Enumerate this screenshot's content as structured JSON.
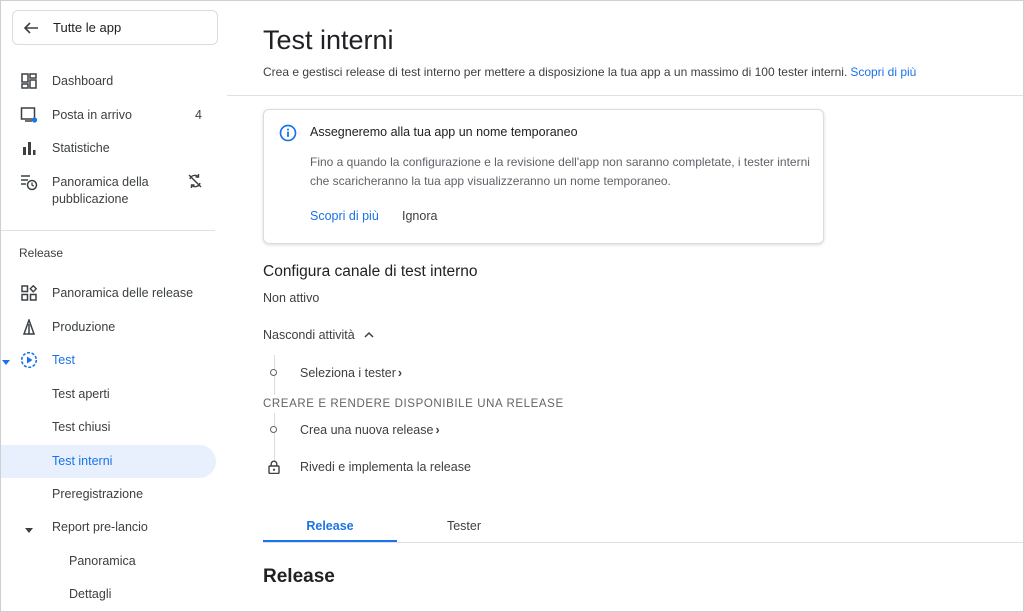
{
  "sidebar": {
    "back_label": "Tutte le app",
    "top_items": [
      {
        "label": "Dashboard",
        "icon": "dashboard-icon"
      },
      {
        "label": "Posta in arrivo",
        "icon": "inbox-icon",
        "badge": "4"
      },
      {
        "label": "Statistiche",
        "icon": "bar-chart-icon"
      },
      {
        "label": "Panoramica della pubblicazione",
        "icon": "publishing-overview-icon",
        "status_icon": "sync-off-icon"
      }
    ],
    "release_section_label": "Release",
    "release_items": [
      {
        "label": "Panoramica delle release",
        "icon": "release-overview-icon"
      },
      {
        "label": "Produzione",
        "icon": "production-icon"
      },
      {
        "label": "Test",
        "icon": "test-play-icon"
      },
      {
        "label": "Test aperti"
      },
      {
        "label": "Test chiusi"
      },
      {
        "label": "Test interni"
      },
      {
        "label": "Preregistrazione"
      },
      {
        "label": "Report pre-lancio"
      },
      {
        "label": "Panoramica"
      },
      {
        "label": "Dettagli"
      }
    ]
  },
  "main": {
    "title": "Test interni",
    "description": "Crea e gestisci release di test interno per mettere a disposizione la tua app a un massimo di 100 tester interni.",
    "description_link": "Scopri di più",
    "notice": {
      "title": "Assegneremo alla tua app un nome temporaneo",
      "body": "Fino a quando la configurazione e la revisione dell'app non saranno completate, i tester interni che scaricheranno la tua app visualizzeranno un nome temporaneo.",
      "link": "Scopri di più",
      "dismiss": "Ignora"
    },
    "config_title": "Configura canale di test interno",
    "status": "Non attivo",
    "toggle_tasks": "Nascondi attività",
    "task_select_testers": "Seleziona i tester",
    "release_subsection": "CREARE E RENDERE DISPONIBILE UNA RELEASE",
    "task_create_release": "Crea una nuova release",
    "task_review_release": "Rivedi e implementa la release",
    "tabs": [
      {
        "label": "Release",
        "active": true
      },
      {
        "label": "Tester",
        "active": false
      }
    ],
    "release_heading": "Release"
  },
  "colors": {
    "accent": "#1a73e8",
    "active_bg": "#e8f0fe",
    "text": "#202124",
    "muted": "#5f6368"
  }
}
